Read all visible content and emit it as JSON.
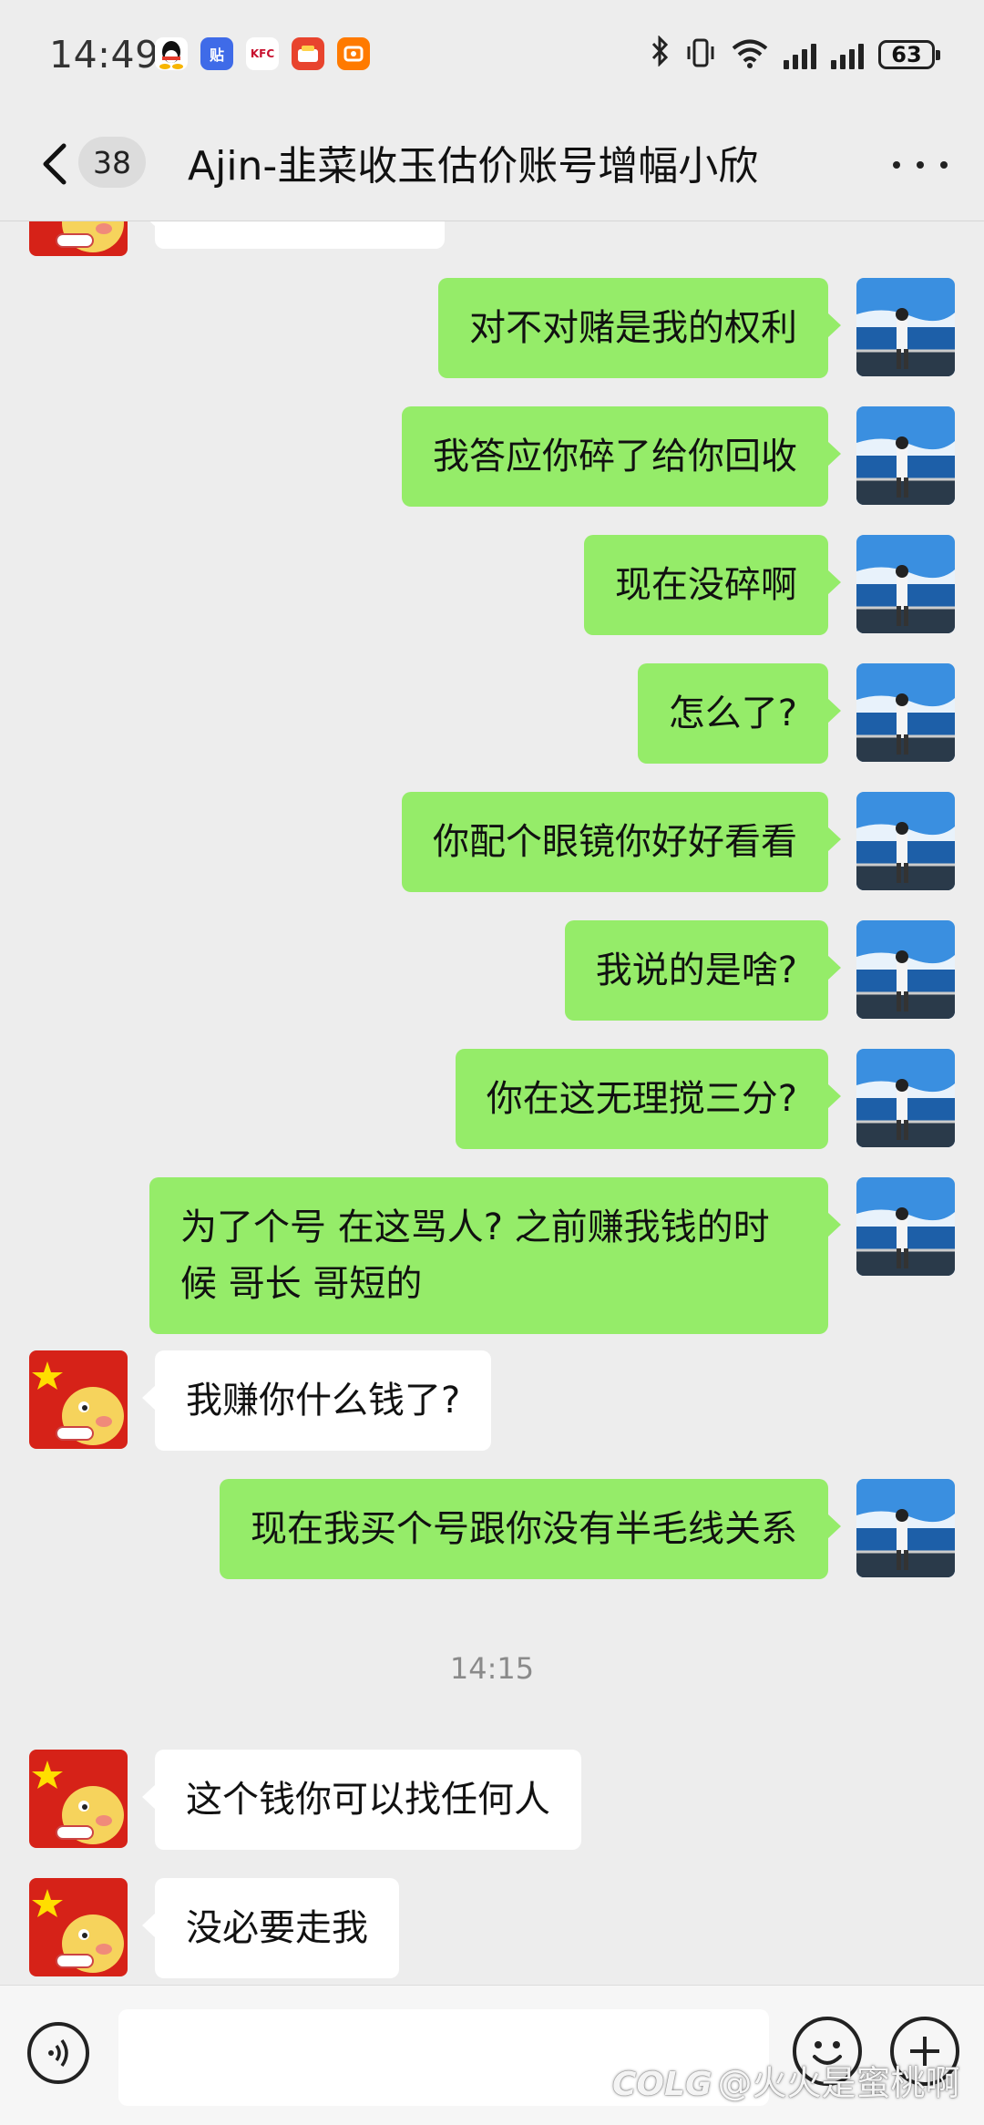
{
  "status_bar": {
    "time": "14:49",
    "battery": "63",
    "notification_icons": [
      {
        "name": "qq-icon",
        "label": ""
      },
      {
        "name": "tieba-icon",
        "label": "贴"
      },
      {
        "name": "kfc-icon",
        "label": "KFC"
      },
      {
        "name": "food-delivery-icon",
        "label": ""
      },
      {
        "name": "app-notification-icon",
        "label": ""
      }
    ]
  },
  "header": {
    "unread_count": "38",
    "title": "Ajin-韭菜收玉估价账号增幅小欣"
  },
  "messages": [
    {
      "sender": "me",
      "text": "对不对赌是我的权利"
    },
    {
      "sender": "me",
      "text": "我答应你碎了给你回收"
    },
    {
      "sender": "me",
      "text": "现在没碎啊"
    },
    {
      "sender": "me",
      "text": "怎么了?"
    },
    {
      "sender": "me",
      "text": "你配个眼镜你好好看看"
    },
    {
      "sender": "me",
      "text": "我说的是啥?"
    },
    {
      "sender": "me",
      "text": "你在这无理搅三分?"
    },
    {
      "sender": "me",
      "text": "为了个号 在这骂人? 之前赚我钱的时候 哥长 哥短的"
    },
    {
      "sender": "other",
      "text": "我赚你什么钱了?"
    },
    {
      "sender": "me",
      "text": "现在我买个号跟你没有半毛线关系"
    },
    {
      "sender": "other",
      "text": "这个钱你可以找任何人"
    },
    {
      "sender": "other",
      "text": "没必要走我"
    }
  ],
  "timestamp": "14:15",
  "watermark": {
    "logo": "COLG",
    "text": "@火火是蜜桃啊"
  },
  "colors": {
    "my_bubble": "#95ec69",
    "other_bubble": "#ffffff",
    "background": "#ededed"
  }
}
